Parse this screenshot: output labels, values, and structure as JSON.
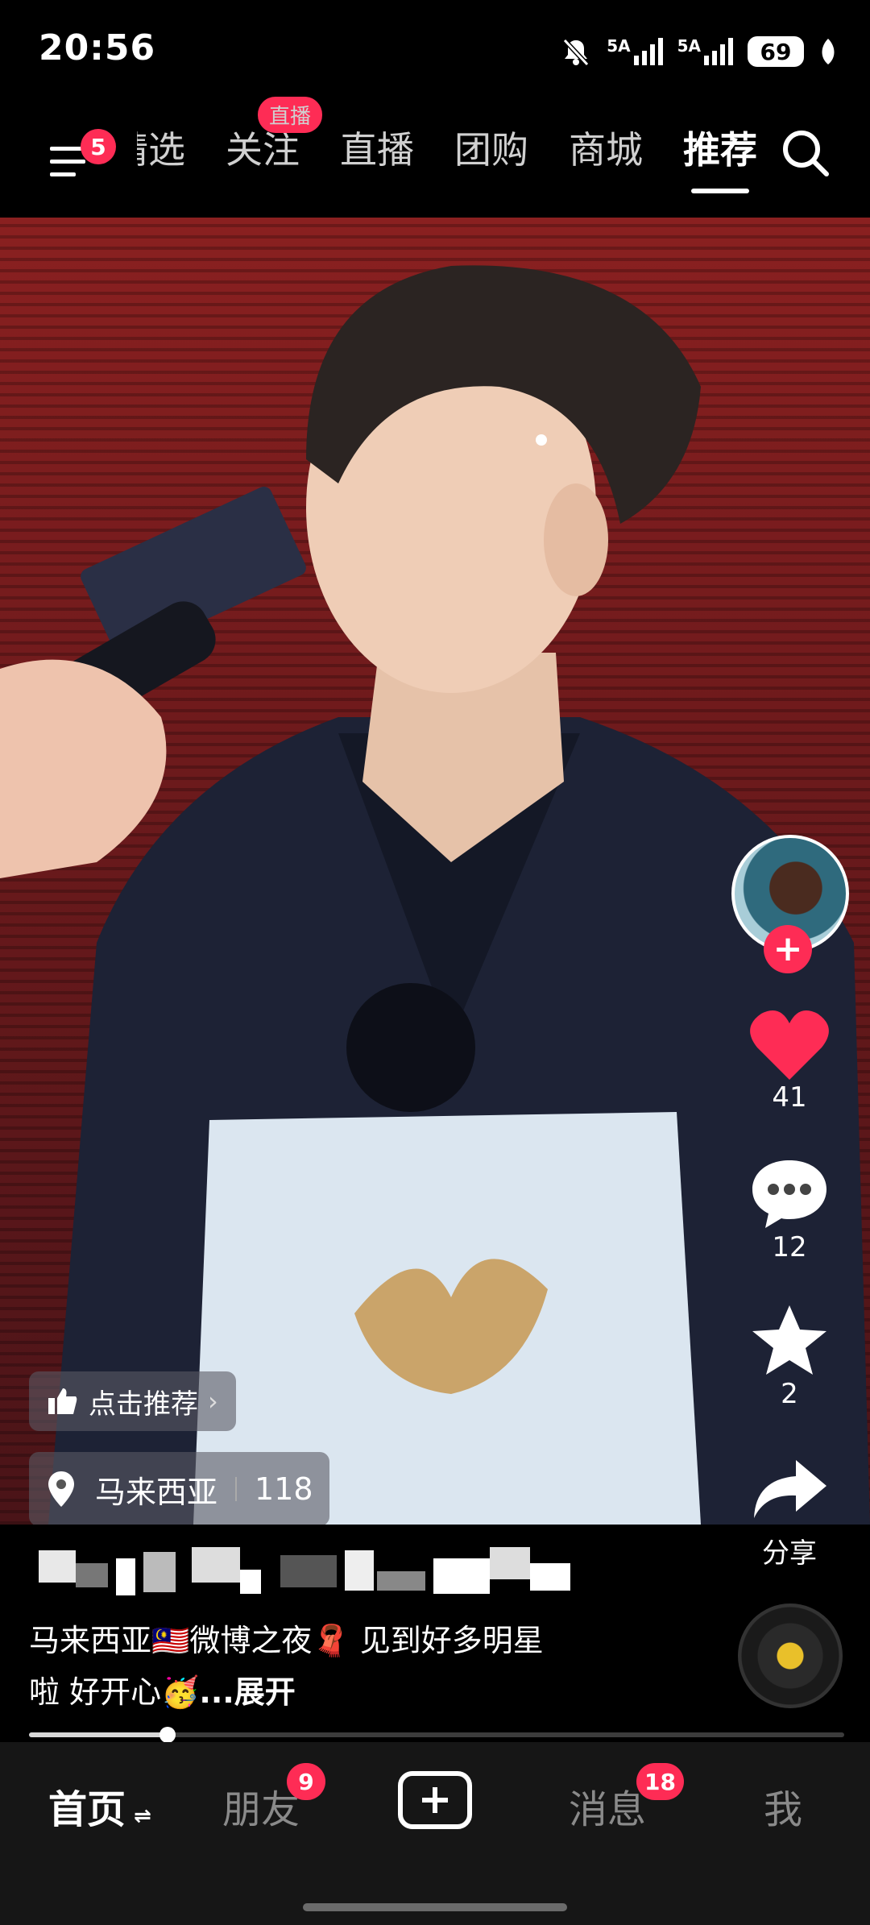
{
  "status_bar": {
    "time": "20:56",
    "signal1_label": "5A",
    "signal2_label": "5A",
    "battery": "69"
  },
  "top_nav": {
    "menu_badge": "5",
    "tabs": [
      {
        "label": "精选"
      },
      {
        "label": "关注",
        "badge": "直播"
      },
      {
        "label": "直播"
      },
      {
        "label": "团购"
      },
      {
        "label": "商城"
      },
      {
        "label": "推荐",
        "active": true
      }
    ]
  },
  "video": {
    "recommend_label": "点击推荐",
    "location": "马来西亚",
    "location_count": "118"
  },
  "side_actions": {
    "likes": "41",
    "comments": "12",
    "favorites": "2",
    "share_label": "分享"
  },
  "caption": {
    "text_line1": "马来西亚🇲🇾微博之夜🧣 见到好多明星",
    "text_line2": "啦 好开心🥳",
    "expand": "...展开"
  },
  "progress": {
    "fraction": 0.17
  },
  "bottom_nav": {
    "home": "首页",
    "home_switch": "⇌",
    "friends": "朋友",
    "friends_badge": "9",
    "messages": "消息",
    "messages_badge": "18",
    "me": "我"
  },
  "colors": {
    "accent": "#fe2c55",
    "background": "#000000",
    "nav_bg": "#161616"
  }
}
